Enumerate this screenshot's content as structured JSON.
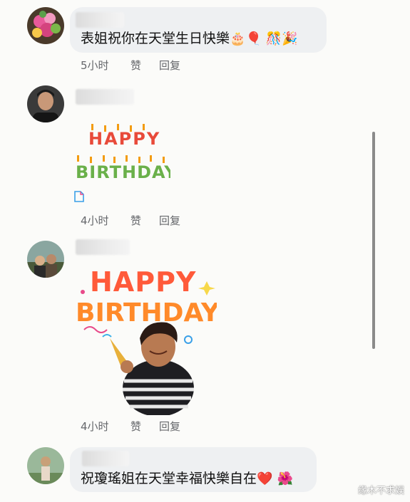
{
  "comments": [
    {
      "text": "表姐祝你在天堂生日快樂",
      "emojis": [
        "🎂",
        "🎈",
        "🎊",
        "🎉"
      ],
      "time": "5小时",
      "like": "赞",
      "reply": "回复"
    },
    {
      "sticker_lines": [
        "HAPPY",
        "BIRTHDAY"
      ],
      "sticker_icon": "document-icon",
      "time": "4小时",
      "like": "赞",
      "reply": "回复"
    },
    {
      "sticker_lines": [
        "HAPPY",
        "BIRTHDAY"
      ],
      "time": "4小时",
      "like": "赞",
      "reply": "回复"
    },
    {
      "text": "祝瓊瑤姐在天堂幸福快樂自在",
      "emojis": [
        "❤️",
        "🌺"
      ]
    }
  ],
  "watermark": "缘木不求娱",
  "colors": {
    "bubble": "#eef0f2",
    "meta": "#65676b",
    "scrollbar": "#8a8a8a"
  }
}
